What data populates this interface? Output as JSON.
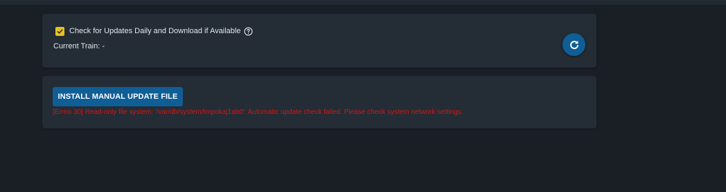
{
  "updates_card": {
    "auto_update_label": "Check for Updates Daily and Download if Available",
    "auto_update_checked": true,
    "current_train_label": "Current Train:",
    "current_train_value": "-"
  },
  "manual_card": {
    "install_button_label": "INSTALL MANUAL UPDATE FILE",
    "error_message": "[Errno 30] Read-only file system: '/var/db/system/tmpokaj1ab0': Automatic update check failed. Please check system network settings."
  },
  "icons": {
    "checkbox": "check-icon",
    "help": "help-circle-icon",
    "refresh": "refresh-icon"
  },
  "colors": {
    "background": "#1a1f26",
    "card": "#242c35",
    "accent": "#0f5e96",
    "checkbox": "#e8c11c",
    "error": "#d0181a"
  }
}
